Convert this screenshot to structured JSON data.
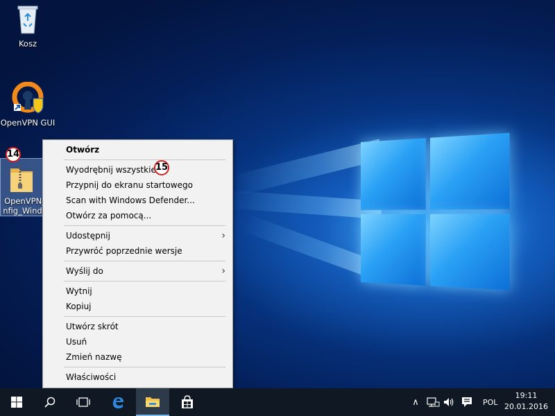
{
  "desktop": {
    "icons": [
      {
        "label": "Kosz"
      },
      {
        "label": "OpenVPN GUI"
      },
      {
        "label": "OpenVPN_\nnfig_Windo"
      }
    ],
    "markers": {
      "zip_marker": "14",
      "extract_marker": "15"
    }
  },
  "context_menu": {
    "items": [
      {
        "label": "Otwórz"
      },
      {
        "label": "Wyodrębnij wszystkie..."
      },
      {
        "label": "Przypnij do ekranu startowego"
      },
      {
        "label": "Scan with Windows Defender..."
      },
      {
        "label": "Otwórz za pomocą..."
      },
      {
        "label": "Udostępnij"
      },
      {
        "label": "Przywróć poprzednie wersje"
      },
      {
        "label": "Wyślij do"
      },
      {
        "label": "Wytnij"
      },
      {
        "label": "Kopiuj"
      },
      {
        "label": "Utwórz skrót"
      },
      {
        "label": "Usuń"
      },
      {
        "label": "Zmień nazwę"
      },
      {
        "label": "Właściwości"
      }
    ]
  },
  "taskbar": {
    "language": "POL",
    "time": "19:11",
    "date": "20.01.2016",
    "accent_color": "#76b9ed"
  }
}
